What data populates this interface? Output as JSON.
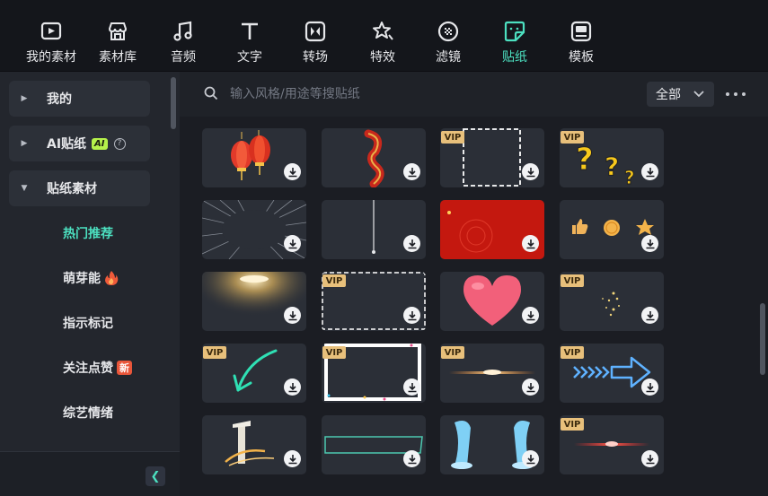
{
  "toolbar": {
    "tabs": [
      {
        "label": "我的素材",
        "icon": "media-icon"
      },
      {
        "label": "素材库",
        "icon": "store-icon"
      },
      {
        "label": "音频",
        "icon": "music-note-icon"
      },
      {
        "label": "文字",
        "icon": "text-icon"
      },
      {
        "label": "转场",
        "icon": "transition-icon"
      },
      {
        "label": "特效",
        "icon": "effects-star-icon"
      },
      {
        "label": "滤镜",
        "icon": "filter-icon"
      },
      {
        "label": "贴纸",
        "icon": "sticker-icon",
        "active": true
      },
      {
        "label": "模板",
        "icon": "template-icon"
      }
    ],
    "active_color": "#4ce0c0"
  },
  "sidebar": {
    "categories": [
      {
        "label": "我的",
        "expanded": false
      },
      {
        "label": "AI贴纸",
        "badge": "AI",
        "expanded": false
      },
      {
        "label": "贴纸素材",
        "expanded": true
      }
    ],
    "subitems": [
      {
        "label": "热门推荐",
        "active": true
      },
      {
        "label": "萌芽能",
        "badge": "fire"
      },
      {
        "label": "指示标记"
      },
      {
        "label": "关注点赞",
        "badge": "新"
      },
      {
        "label": "综艺情绪"
      }
    ]
  },
  "search": {
    "placeholder": "输入风格/用途等搜贴纸",
    "value": ""
  },
  "filter": {
    "selected": "全部"
  },
  "stickers": [
    {
      "name": "red-lanterns",
      "vip": false
    },
    {
      "name": "red-chinese-knot",
      "vip": false
    },
    {
      "name": "dashed-frame",
      "vip": true
    },
    {
      "name": "question-marks",
      "vip": true
    },
    {
      "name": "speed-lines",
      "vip": false
    },
    {
      "name": "vertical-line",
      "vip": false
    },
    {
      "name": "red-background",
      "vip": false
    },
    {
      "name": "thumbs-coin-star",
      "vip": false
    },
    {
      "name": "golden-light-burst",
      "vip": false
    },
    {
      "name": "dashed-rectangle",
      "vip": true
    },
    {
      "name": "pink-heart",
      "vip": false
    },
    {
      "name": "golden-sparkles",
      "vip": true
    },
    {
      "name": "green-check-arrow",
      "vip": true
    },
    {
      "name": "confetti-frame",
      "vip": true
    },
    {
      "name": "orange-lens-flare",
      "vip": true
    },
    {
      "name": "blue-neon-arrow",
      "vip": true
    },
    {
      "name": "golden-pillar",
      "vip": false
    },
    {
      "name": "teal-bracket-frame",
      "vip": false
    },
    {
      "name": "blue-waterfall",
      "vip": false
    },
    {
      "name": "red-lens-flare",
      "vip": true
    }
  ],
  "vip_label": "VIP",
  "vip_color": "#e8c07b"
}
